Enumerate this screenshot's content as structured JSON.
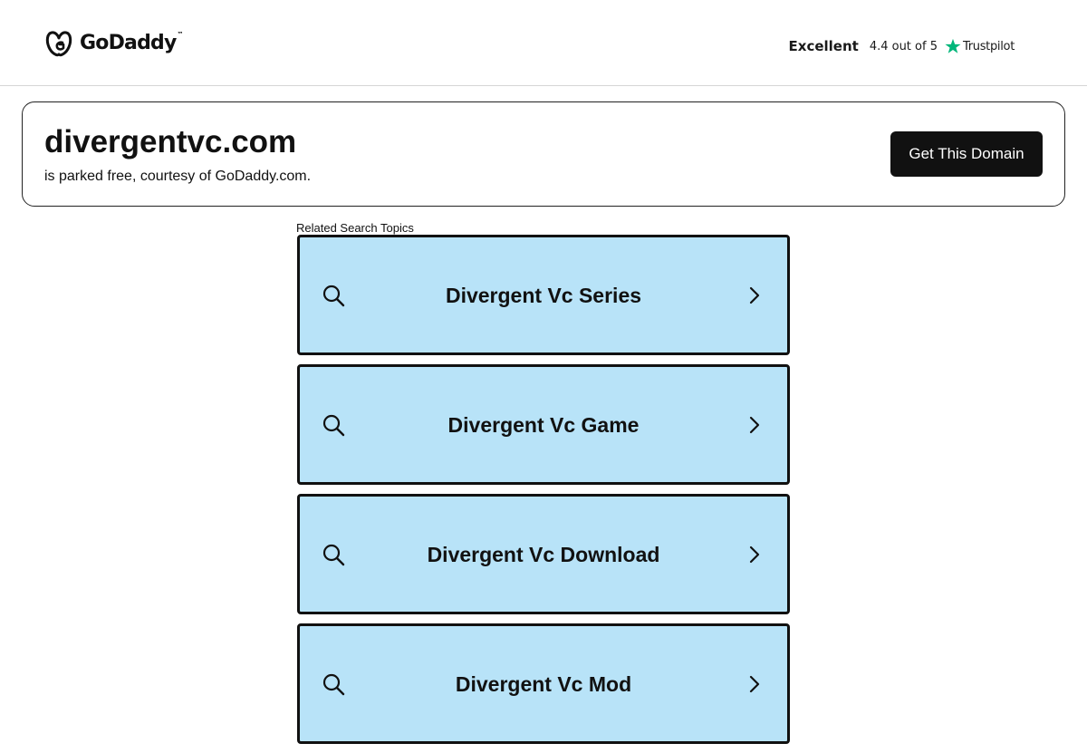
{
  "header": {
    "logo_text": "GoDaddy",
    "logo_tm": "™",
    "trust_excellent": "Excellent",
    "trust_rating": "4.4 out of 5",
    "trust_brand": "Trustpilot"
  },
  "domain": {
    "name": "divergentvc.com",
    "subtitle": "is parked free, courtesy of GoDaddy.com.",
    "cta_label": "Get This Domain"
  },
  "related": {
    "label": "Related Search Topics",
    "topics": [
      {
        "label": "Divergent Vc Series"
      },
      {
        "label": "Divergent Vc Game"
      },
      {
        "label": "Divergent Vc Download"
      },
      {
        "label": "Divergent Vc Mod"
      }
    ]
  },
  "colors": {
    "topic_bg": "#b8e3f8",
    "button_bg": "#111111",
    "trustpilot_green": "#00b67a"
  },
  "icons": {
    "search": "search-icon",
    "chevron": "chevron-right-icon",
    "logo": "godaddy-logo-icon",
    "star": "trustpilot-star-icon"
  }
}
